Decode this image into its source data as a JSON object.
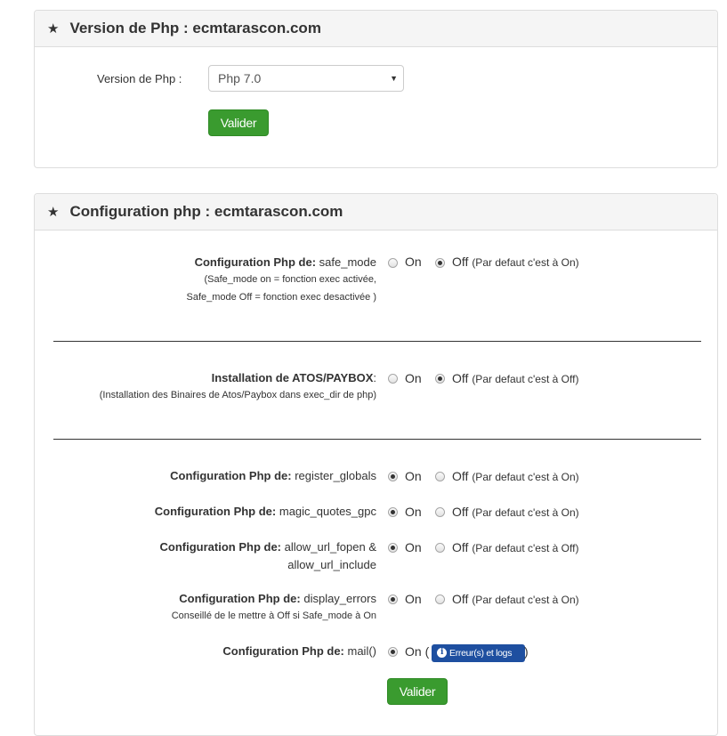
{
  "panel1": {
    "title": "Version de Php : ecmtarascon.com",
    "version_label": "Version de Php :",
    "version_value": "Php 7.0",
    "submit": "Valider"
  },
  "panel2": {
    "title": "Configuration php : ecmtarascon.com",
    "prefix": "Configuration Php de:",
    "on": "On",
    "off": "Off",
    "safe_mode": {
      "name": "safe_mode",
      "note1": "(Safe_mode on = fonction exec activée,",
      "note2": "Safe_mode Off = fonction exec desactivée )",
      "default": "(Par defaut c'est à On)",
      "selected": "Off"
    },
    "atos": {
      "label": "Installation de ATOS/PAYBOX",
      "note": "(Installation des Binaires de Atos/Paybox dans exec_dir de php)",
      "default": "(Par defaut c'est à Off)",
      "selected": "Off"
    },
    "register_globals": {
      "name": "register_globals",
      "default": "(Par defaut c'est à On)",
      "selected": "On"
    },
    "magic_quotes": {
      "name": "magic_quotes_gpc",
      "default": "(Par defaut c'est à On)",
      "selected": "On"
    },
    "allow_url": {
      "name1": "allow_url_fopen &",
      "name2": "allow_url_include",
      "default": "(Par defaut c'est à Off)",
      "selected": "On"
    },
    "display_errors": {
      "name": "display_errors",
      "note": "Conseillé de le mettre à Off si Safe_mode à On",
      "default": "(Par defaut c'est à On)",
      "selected": "On"
    },
    "mail": {
      "name": "mail()",
      "paren_open": "(",
      "paren_close": ")",
      "logs_button": "Erreur(s) et logs",
      "selected": "On"
    },
    "submit": "Valider"
  },
  "icons": {
    "heading": "star-icon",
    "info": "info-icon",
    "dropdown": "caret-down-icon"
  }
}
